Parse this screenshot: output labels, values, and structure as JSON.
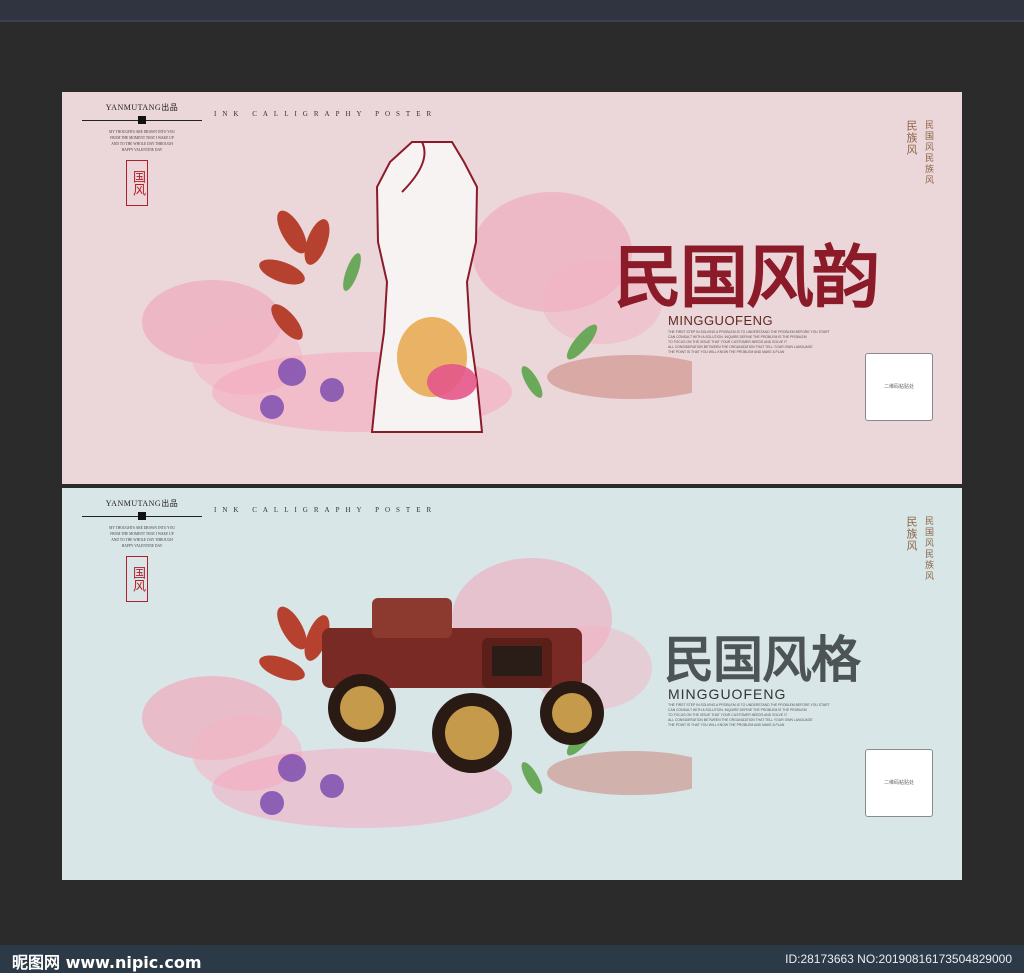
{
  "poster_1": {
    "brand": "YANMUTANG出品",
    "brand_lines": [
      "MY THOUGHTS ARE DRAWN INTO YOU",
      "FROM THE MOMENT THAT I WAKE UP",
      "AND TO THE WHOLE DAY THROUGH",
      "HAPPY VALENTINE DAY"
    ],
    "eyebrow": "INK CALLIGRAPHY POSTER",
    "seal_text": "国风",
    "vertical_a": "民族风",
    "vertical_b": "民国风民族风",
    "title_cn": "民国风韵",
    "title_en": "MINGGUOFENG",
    "blurb": [
      "THE FIRST STEP IN SOLVING A PROBLEM IS TO UNDERSTAND THE PROBLEM BEFORE YOU START",
      "CAN CONSULT WITH A SOLUTION. INQUIRE DEFINE THE PROBLEM IS THE PROBLEM",
      "TO FOCUS ON THE ISSUE THAT YOUR CUSTOMER NEEDS AND SOLVE IT",
      "ALL CONSIDERATION BETWEEN THE ORGANIZATION THAT TELL YOUR OWN LANGUAGE",
      "THE POINT IS THAT YOU WILL KNOW THE PROBLEM AND MAKE A PLAN"
    ],
    "qr_label": "二维码粘贴处"
  },
  "poster_2": {
    "brand": "YANMUTANG出品",
    "brand_lines": [
      "MY THOUGHTS ARE DRAWN INTO YOU",
      "FROM THE MOMENT THAT I WAKE UP",
      "AND TO THE WHOLE DAY THROUGH",
      "HAPPY VALENTINE DAY"
    ],
    "eyebrow": "INK CALLIGRAPHY POSTER",
    "seal_text": "国风",
    "vertical_a": "民族风",
    "vertical_b": "民国风民族风",
    "title_cn": "民国风格",
    "title_en": "MINGGUOFENG",
    "blurb": [
      "THE FIRST STEP IN SOLVING A PROBLEM IS TO UNDERSTAND THE PROBLEM BEFORE YOU START",
      "CAN CONSULT WITH A SOLUTION. INQUIRE DEFINE THE PROBLEM IS THE PROBLEM",
      "TO FOCUS ON THE ISSUE THAT YOUR CUSTOMER NEEDS AND SOLVE IT",
      "ALL CONSIDERATION BETWEEN THE ORGANIZATION THAT TELL YOUR OWN LANGUAGE",
      "THE POINT IS THAT YOU WILL KNOW THE PROBLEM AND MAKE A PLAN"
    ],
    "qr_label": "二维码粘贴处"
  },
  "footer": {
    "site_logo": "昵图网 www.nipic.com",
    "image_id": "ID:28173663 NO:20190816173504829000"
  },
  "colors": {
    "poster_1_background": "#ebd6d9",
    "poster_2_background": "#d9e6e8",
    "title_red": "#8c1b2a",
    "title_grey": "#4d5456",
    "seal_red": "#b41d2a"
  }
}
